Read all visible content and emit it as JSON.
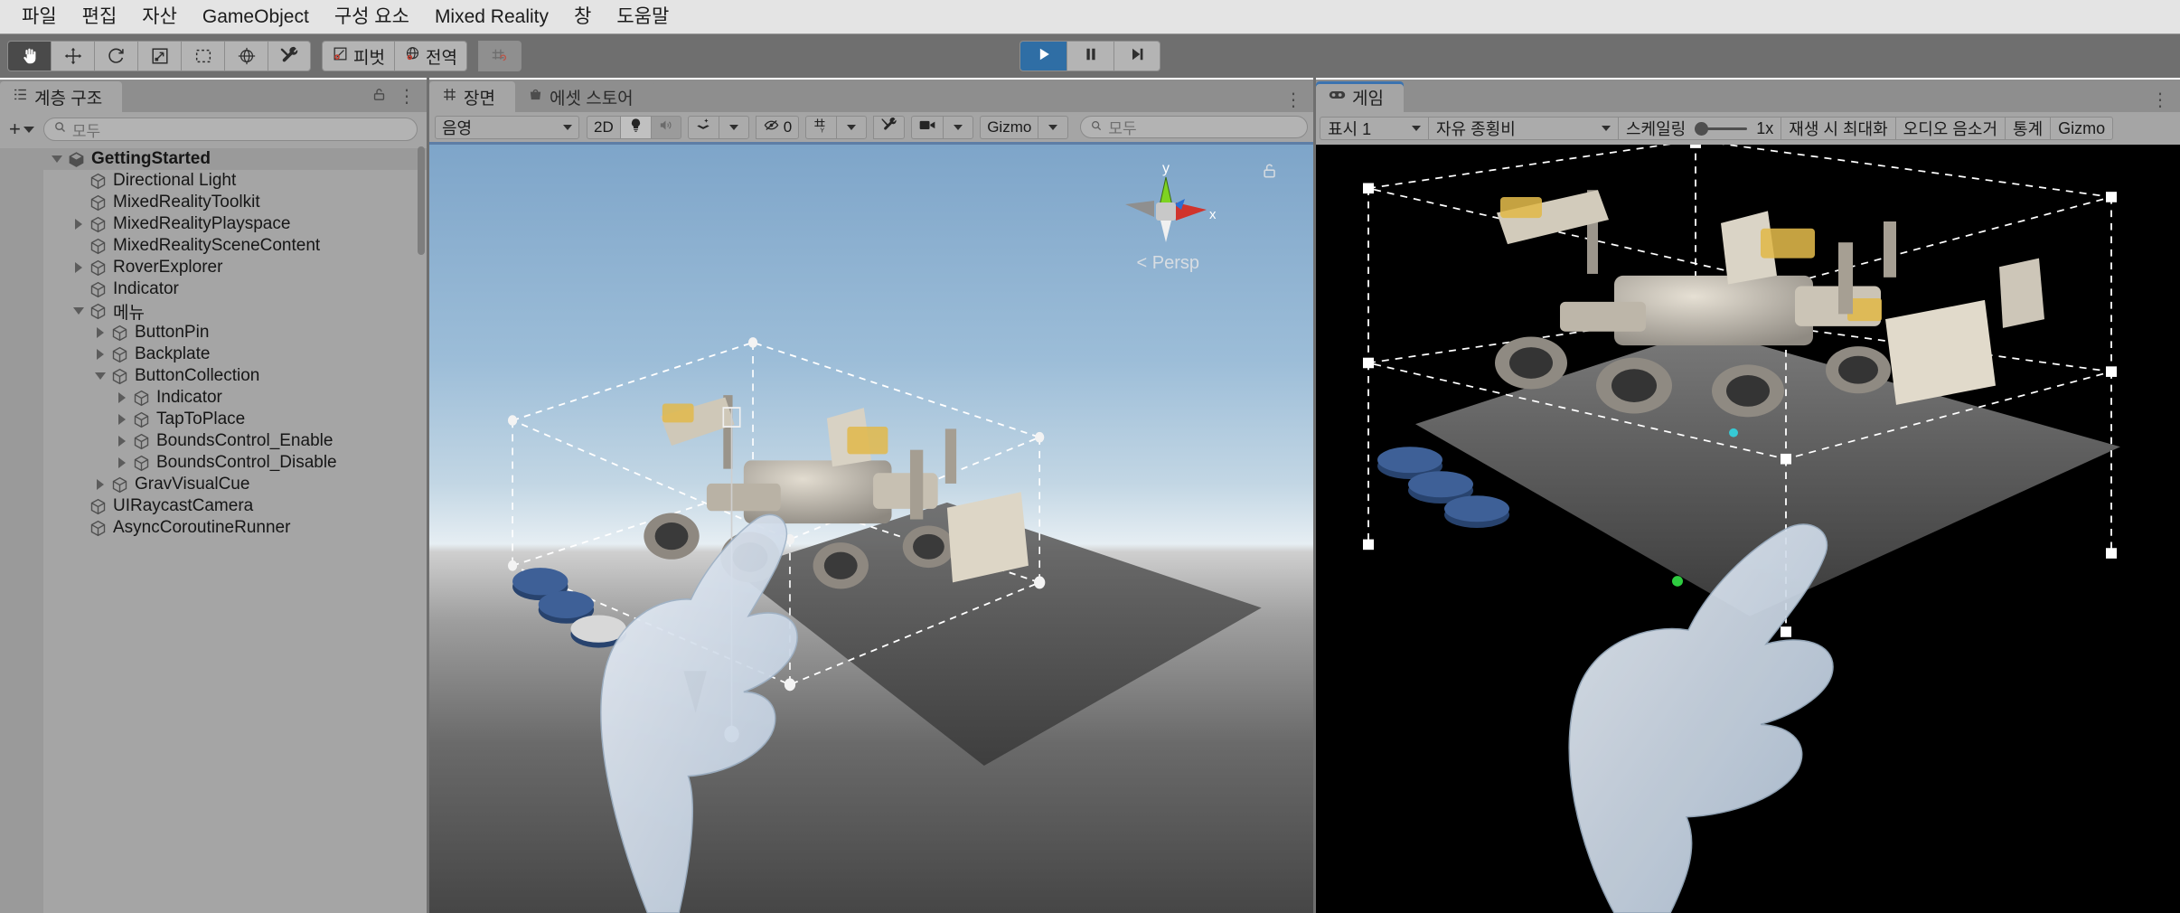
{
  "menubar": {
    "items": [
      {
        "label": "파일"
      },
      {
        "label": "편집"
      },
      {
        "label": "자산"
      },
      {
        "label": "GameObject"
      },
      {
        "label": "구성 요소"
      },
      {
        "label": "Mixed Reality"
      },
      {
        "label": "창"
      },
      {
        "label": "도움말"
      }
    ]
  },
  "toolbar": {
    "tools": [
      {
        "name": "hand-tool",
        "active": true
      },
      {
        "name": "move-tool",
        "active": false
      },
      {
        "name": "rotate-tool",
        "active": false
      },
      {
        "name": "scale-tool",
        "active": false
      },
      {
        "name": "rect-tool",
        "active": false
      },
      {
        "name": "transform-tool",
        "active": false
      },
      {
        "name": "custom-editor-tool",
        "active": false
      }
    ],
    "pivot_label": "피벗",
    "handle_label": "전역",
    "snap_label": "",
    "play_label": "재생",
    "pause_label": "일시정지",
    "step_label": "스텝",
    "play_active": true,
    "accent_blue": "#2f6ea5"
  },
  "hierarchy": {
    "tab_label": "계층 구조",
    "search_placeholder": "모두",
    "add_label": "+",
    "tree": [
      {
        "label": "GettingStarted",
        "depth": 0,
        "expand": "down",
        "icon": "scene-icon",
        "bold": true,
        "selected": true
      },
      {
        "label": "Directional Light",
        "depth": 1,
        "expand": "none",
        "icon": "gameobject-icon",
        "bold": false,
        "selected": false
      },
      {
        "label": "MixedRealityToolkit",
        "depth": 1,
        "expand": "none",
        "icon": "gameobject-icon",
        "bold": false,
        "selected": false
      },
      {
        "label": "MixedRealityPlayspace",
        "depth": 1,
        "expand": "right",
        "icon": "gameobject-icon",
        "bold": false,
        "selected": false
      },
      {
        "label": "MixedRealitySceneContent",
        "depth": 1,
        "expand": "none",
        "icon": "gameobject-icon",
        "bold": false,
        "selected": false
      },
      {
        "label": "RoverExplorer",
        "depth": 1,
        "expand": "right",
        "icon": "gameobject-icon",
        "bold": false,
        "selected": false
      },
      {
        "label": "Indicator",
        "depth": 1,
        "expand": "none",
        "icon": "gameobject-icon",
        "bold": false,
        "selected": false
      },
      {
        "label": "메뉴",
        "depth": 1,
        "expand": "down",
        "icon": "gameobject-icon",
        "bold": false,
        "selected": false
      },
      {
        "label": "ButtonPin",
        "depth": 2,
        "expand": "right",
        "icon": "gameobject-icon",
        "bold": false,
        "selected": false
      },
      {
        "label": "Backplate",
        "depth": 2,
        "expand": "right",
        "icon": "gameobject-icon",
        "bold": false,
        "selected": false
      },
      {
        "label": "ButtonCollection",
        "depth": 2,
        "expand": "down",
        "icon": "gameobject-icon",
        "bold": false,
        "selected": false
      },
      {
        "label": "Indicator",
        "depth": 3,
        "expand": "right",
        "icon": "gameobject-icon",
        "bold": false,
        "selected": false
      },
      {
        "label": "TapToPlace",
        "depth": 3,
        "expand": "right",
        "icon": "gameobject-icon",
        "bold": false,
        "selected": false
      },
      {
        "label": "BoundsControl_Enable",
        "depth": 3,
        "expand": "right",
        "icon": "gameobject-icon",
        "bold": false,
        "selected": false
      },
      {
        "label": "BoundsControl_Disable",
        "depth": 3,
        "expand": "right",
        "icon": "gameobject-icon",
        "bold": false,
        "selected": false
      },
      {
        "label": "GravVisualCue",
        "depth": 2,
        "expand": "right",
        "icon": "gameobject-icon",
        "bold": false,
        "selected": false
      },
      {
        "label": "UIRaycastCamera",
        "depth": 1,
        "expand": "none",
        "icon": "gameobject-icon",
        "bold": false,
        "selected": false
      },
      {
        "label": "AsyncCoroutineRunner",
        "depth": 1,
        "expand": "none",
        "icon": "gameobject-icon",
        "bold": false,
        "selected": false
      }
    ]
  },
  "scene": {
    "tab_label": "장면",
    "asset_store_tab_label": "에셋 스토어",
    "draw_mode_label": "음영",
    "two_d_label": "2D",
    "hidden_count_label": "0",
    "gizmo_label": "Gizmo",
    "search_placeholder": "모두",
    "persp_label": "Persp",
    "axis_x_label": "x",
    "axis_y_label": "y"
  },
  "game": {
    "tab_label": "게임",
    "display_label": "표시 1",
    "aspect_label": "자유 종횡비",
    "scale_label": "스케일링",
    "scale_value": "1x",
    "maximize_label": "재생 시 최대화",
    "mute_label": "오디오 음소거",
    "stats_label": "통계",
    "gizmos_label": "Gizmo"
  }
}
